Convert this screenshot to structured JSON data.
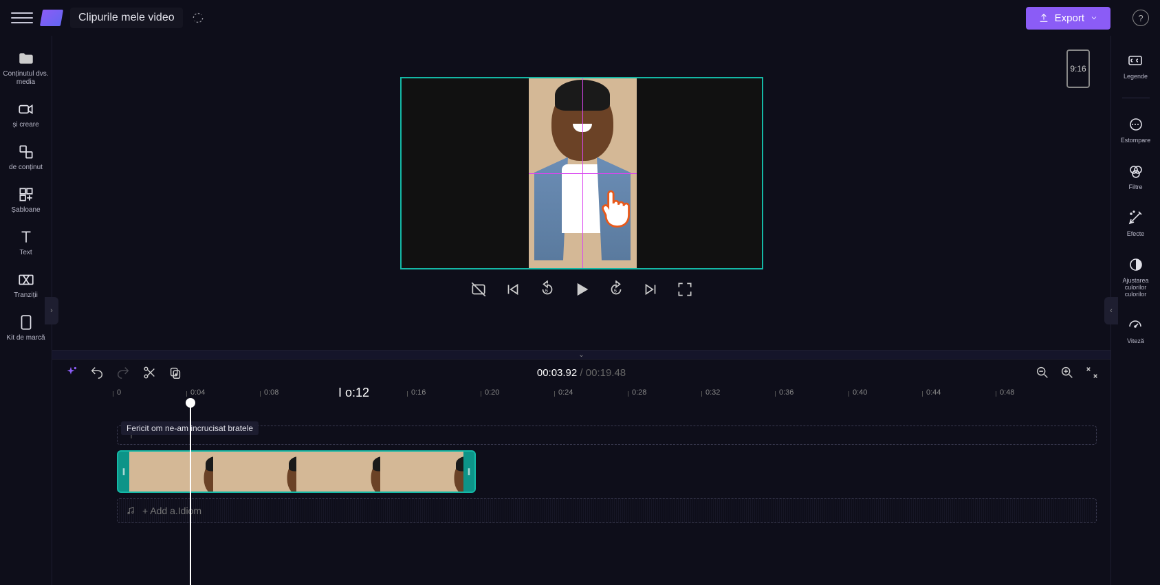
{
  "header": {
    "project_name": "Clipurile mele video",
    "export_label": "Export"
  },
  "preview": {
    "aspect_label": "9:16"
  },
  "sidebar_left": {
    "media": "Conținutul dvs. media",
    "record": "și creare",
    "library": "de conținut",
    "templates": "Șabloane",
    "text": "Text",
    "transitions": "Tranziții",
    "brand": "Kit de marcă"
  },
  "sidebar_right": {
    "captions": "Legende",
    "fade": "Estompare",
    "filters": "Filtre",
    "effects": "Efecte",
    "colors": "Ajustarea culorilor",
    "colors2": "culorilor",
    "speed": "Viteză"
  },
  "timeline": {
    "current_time": "00:03.92",
    "total_time": "00:19.48",
    "clip_tooltip": "Fericit om ne-am incrucisat bratele",
    "audio_placeholder": "+ Add a.Idiom",
    "featured_mark": "I o:12",
    "marks": [
      "0",
      "0:04",
      "0:08",
      "",
      "0:16",
      "0:20",
      "0:24",
      "0:28",
      "0:32",
      "0:36",
      "0:40",
      "0:44",
      "0:48"
    ]
  }
}
